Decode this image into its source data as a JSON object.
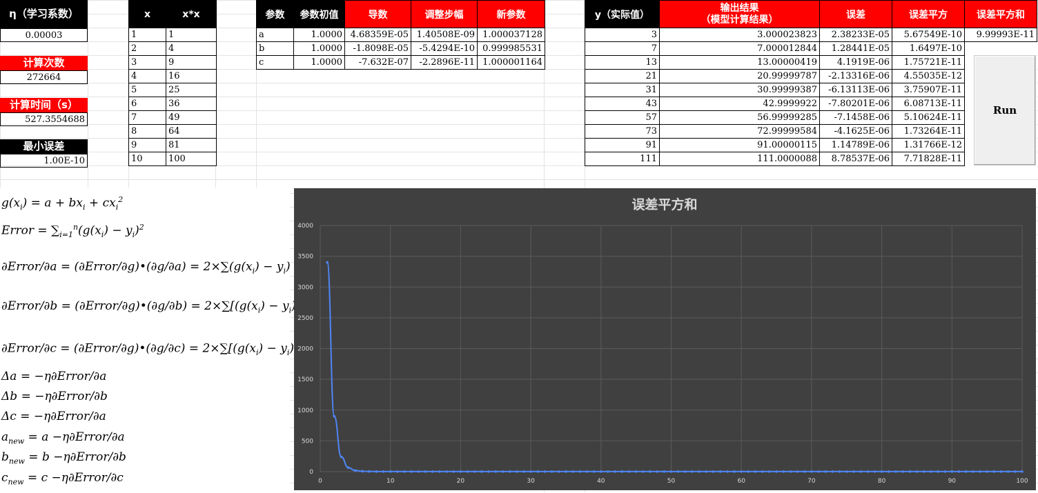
{
  "left_panel": {
    "eta_label": "η（学习系数）",
    "eta_value": "0.00003",
    "iter_label": "计算次数",
    "iter_value": "272664",
    "time_label": "计算时间（s）",
    "time_value": "527.3554688",
    "minerr_label": "最小误差",
    "minerr_value": "1.00E-10"
  },
  "x_table": {
    "headers": [
      "x",
      "x*x"
    ],
    "rows": [
      [
        "1",
        "1"
      ],
      [
        "2",
        "4"
      ],
      [
        "3",
        "9"
      ],
      [
        "4",
        "16"
      ],
      [
        "5",
        "25"
      ],
      [
        "6",
        "36"
      ],
      [
        "7",
        "49"
      ],
      [
        "8",
        "64"
      ],
      [
        "9",
        "81"
      ],
      [
        "10",
        "100"
      ]
    ]
  },
  "param_table": {
    "headers": [
      "参数",
      "参数初值",
      "导数",
      "调整步幅",
      "新参数"
    ],
    "rows": [
      [
        "a",
        "1.0000",
        "4.68359E-05",
        "1.40508E-09",
        "1.000037128"
      ],
      [
        "b",
        "1.0000",
        "-1.8098E-05",
        "-5.4294E-10",
        "0.999985531"
      ],
      [
        "c",
        "1.0000",
        "-7.632E-07",
        "-2.2896E-11",
        "1.000001164"
      ]
    ]
  },
  "result_table": {
    "headers": [
      "y（实际值）",
      "输出结果",
      "（模型计算结果）",
      "误差",
      "误差平方",
      "误差平方和"
    ],
    "rows": [
      [
        "3",
        "3.000023823",
        "2.38233E-05",
        "5.67549E-10"
      ],
      [
        "7",
        "7.000012844",
        "1.28441E-05",
        "1.6497E-10"
      ],
      [
        "13",
        "13.00000419",
        "4.1919E-06",
        "1.75721E-11"
      ],
      [
        "21",
        "20.99999787",
        "-2.13316E-06",
        "4.55035E-12"
      ],
      [
        "31",
        "30.99999387",
        "-6.13113E-06",
        "3.75907E-11"
      ],
      [
        "43",
        "42.9999922",
        "-7.80201E-06",
        "6.08713E-11"
      ],
      [
        "57",
        "56.99999285",
        "-7.1458E-06",
        "5.10624E-11"
      ],
      [
        "73",
        "72.99999584",
        "-4.1625E-06",
        "1.73264E-11"
      ],
      [
        "91",
        "91.00000115",
        "1.14789E-06",
        "1.31766E-12"
      ],
      [
        "111",
        "111.0000088",
        "8.78537E-06",
        "7.71828E-11"
      ]
    ],
    "sum_value": "9.99993E-11"
  },
  "run_button": {
    "label": "Run"
  },
  "colors": {
    "header_black": "#000000",
    "header_red": "#ff0000",
    "chart_bg": "#404040",
    "series": "#4f86f7"
  },
  "chart_data": {
    "type": "line",
    "title": "误差平方和",
    "xlabel": "",
    "ylabel": "",
    "xlim": [
      0,
      100
    ],
    "ylim": [
      0,
      4000
    ],
    "x_ticks": [
      "0",
      "10",
      "20",
      "30",
      "40",
      "50",
      "60",
      "70",
      "80",
      "90",
      "100"
    ],
    "y_ticks": [
      "0",
      "500",
      "1000",
      "1500",
      "2000",
      "2500",
      "3000",
      "3500",
      "4000"
    ],
    "grid": true,
    "legend": "none",
    "series": [
      {
        "values": [
          3400,
          900,
          240,
          65,
          18,
          6,
          3,
          2,
          1,
          1,
          1,
          1,
          1,
          1,
          1,
          1,
          1,
          1,
          1,
          1,
          1,
          1,
          1,
          1,
          1,
          1,
          1,
          1,
          1,
          1,
          1,
          1,
          1,
          1,
          1,
          1,
          1,
          1,
          1,
          1,
          1,
          1,
          1,
          1,
          1,
          1,
          1,
          1,
          1,
          1,
          1,
          1,
          1,
          1,
          1,
          1,
          1,
          1,
          1,
          1,
          1,
          1,
          1,
          1,
          1,
          1,
          1,
          1,
          1,
          1,
          1,
          1,
          1,
          1,
          1,
          1,
          1,
          1,
          1,
          1,
          1,
          1,
          1,
          1,
          1,
          1,
          1,
          1,
          1,
          1,
          1,
          1,
          1,
          1,
          1,
          1,
          1,
          1,
          1,
          1
        ]
      }
    ]
  }
}
